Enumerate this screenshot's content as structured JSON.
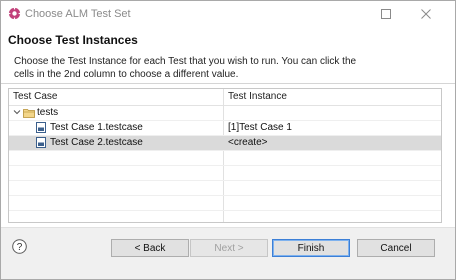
{
  "window": {
    "title": "Choose ALM Test Set"
  },
  "banner": {
    "title": "Choose Test Instances",
    "message": "Choose the Test Instance for each Test that you wish to run.  You can click the cells in the 2nd column to choose a different value."
  },
  "table": {
    "columns": [
      "Test Case",
      "Test Instance"
    ],
    "folder": {
      "label": "tests"
    },
    "rows": [
      {
        "test_case": "Test Case 1.testcase",
        "test_instance": "[1]Test Case 1",
        "selected": false
      },
      {
        "test_case": "Test Case 2.testcase",
        "test_instance": "<create>",
        "selected": true
      }
    ]
  },
  "buttons": {
    "back": "< Back",
    "next": "Next >",
    "finish": "Finish",
    "cancel": "Cancel"
  },
  "colors": {
    "accent": "#3c7fd6",
    "app_icon": "#c2407a",
    "folder": "#d8b25a",
    "selected_row": "#dadada"
  }
}
